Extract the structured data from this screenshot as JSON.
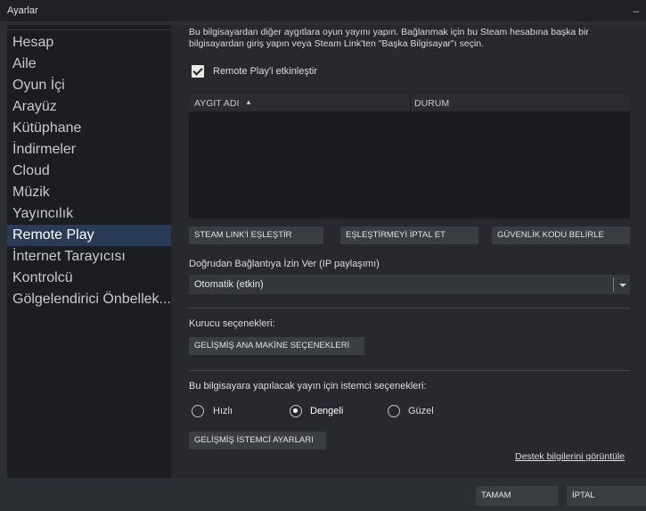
{
  "window": {
    "title": "Ayarlar",
    "minimize_glyph": "_"
  },
  "sidebar": {
    "items": [
      {
        "label": "Hesap"
      },
      {
        "label": "Aile"
      },
      {
        "label": "Oyun İçi"
      },
      {
        "label": "Arayüz"
      },
      {
        "label": "Kütüphane"
      },
      {
        "label": "İndirmeler"
      },
      {
        "label": "Cloud"
      },
      {
        "label": "Müzik"
      },
      {
        "label": "Yayıncılık"
      },
      {
        "label": "Remote Play"
      },
      {
        "label": "İnternet Tarayıcısı"
      },
      {
        "label": "Kontrolcü"
      },
      {
        "label": "Gölgelendirici Önbellek..."
      }
    ],
    "active": "Remote Play"
  },
  "main": {
    "description": "Bu bilgisayardan diğer aygıtlara oyun yayını yapın. Bağlanmak için bu Steam hesabına başka bir bilgisayardan giriş yapın veya Steam Link'ten \"Başka Bilgisayar\"ı seçin.",
    "enable_checkbox": {
      "label": "Remote Play'i etkinleştir",
      "checked": true
    },
    "table": {
      "col_device": "AYGIT ADI",
      "sort_glyph": "▲",
      "col_status": "DURUM"
    },
    "buttons": {
      "pair": "STEAM LINK'İ EŞLEŞTİR",
      "unpair": "EŞLEŞTİRMEYİ İPTAL ET",
      "security_code": "GÜVENLİK KODU BELİRLE"
    },
    "direct_connect": {
      "label": "Doğrudan Bağlantıya İzin Ver (IP paylaşımı)",
      "selected": "Otomatik (etkin)"
    },
    "host": {
      "label": "Kurucu seçenekleri:",
      "button": "GELİŞMİŞ ANA MAKİNE SEÇENEKLERİ"
    },
    "client": {
      "label": "Bu bilgisayara yapılacak yayın için istemci seçenekleri:",
      "options": [
        "Hızlı",
        "Dengeli",
        "Güzel"
      ],
      "selected": "Dengeli",
      "button": "GELİŞMİŞ İSTEMCİ AYARLARI"
    },
    "support_link": "Destek bilgilerini görüntüle"
  },
  "footer": {
    "ok": "TAMAM",
    "cancel": "İPTAL"
  }
}
